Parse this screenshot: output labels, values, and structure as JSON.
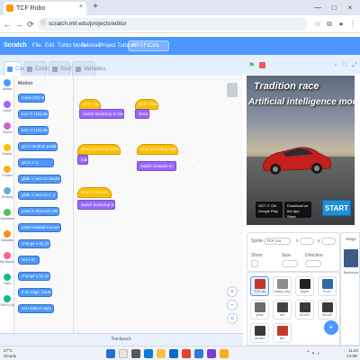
{
  "browser": {
    "tab_title": "TCF Robo",
    "new_tab": "+",
    "close_tab": "×",
    "window_controls": [
      "—",
      "□",
      "×"
    ],
    "url": "scratch.mit.edu/projects/editor",
    "nav": [
      "←",
      "→",
      "⟳"
    ],
    "lock": "ⓘ"
  },
  "menubar": {
    "items": [
      "Scratch",
      "File",
      "Edit",
      "Turbo Mode",
      "Tutorials",
      "Project Tutorial"
    ],
    "project_title": "ARTIFICIAL"
  },
  "editor_tabs": [
    "Code",
    "Costumes",
    "Sounds",
    "Variables"
  ],
  "categories": [
    {
      "name": "Motion",
      "color": "#4c97ff"
    },
    {
      "name": "Looks",
      "color": "#9966ff"
    },
    {
      "name": "Sound",
      "color": "#cf63cf"
    },
    {
      "name": "Events",
      "color": "#ffbf00"
    },
    {
      "name": "Control",
      "color": "#ffab19"
    },
    {
      "name": "Sensing",
      "color": "#5cb1d6"
    },
    {
      "name": "Operators",
      "color": "#59c059"
    },
    {
      "name": "Variables",
      "color": "#ff8c1a"
    },
    {
      "name": "My Blocks",
      "color": "#ff6680"
    },
    {
      "name": "Video",
      "color": "#0fbd8c"
    },
    {
      "name": "Text to Speech",
      "color": "#0fbd8c"
    }
  ],
  "palette": {
    "heading": "Motion",
    "blocks": [
      "move (10) steps",
      "turn ↻ (15) degrees",
      "turn ↺ (15) degrees",
      "go to random position",
      "go to x: y:",
      "glide 1 secs to random position",
      "glide 1 secs to x: y:",
      "point in direction (90)",
      "point towards mouse-pointer",
      "change x by (10)",
      "set x to",
      "change y by (10)",
      "if on edge, bounce",
      "set rotation style"
    ]
  },
  "scripts": {
    "stack1_hat": "when clicked",
    "stack1_b1": "switch backdrop to backdrop1",
    "stack2_hat": "when clicked",
    "stack2_b1": "show",
    "stack3_hat": "when backdrop switches to",
    "stack3_b1": "hide",
    "stack4_hat": "when backdrop switches to",
    "stack4_b1": "switch costume to",
    "stack5_hat": "when I receive",
    "stack5_b1": "switch backdrop to"
  },
  "zoom": {
    "in": "+",
    "out": "−",
    "reset": "="
  },
  "backpack": "Backpack",
  "stage": {
    "title_line1": "Tradition race",
    "title_line2": "Artificial intelligence mode",
    "google_play": "GET IT ON Google Play",
    "app_store": "Download on the App Store",
    "start": "START"
  },
  "sprite_info": {
    "sprite_label": "Sprite",
    "sprite_name": "TCF car",
    "x_label": "x",
    "y_label": "y",
    "show_label": "Show",
    "size_label": "Size",
    "direction_label": "Direction"
  },
  "sprites": [
    {
      "name": "TCF car",
      "color": "#c0392b",
      "selected": true
    },
    {
      "name": "button_trig",
      "color": "#8e8e8e",
      "selected": false
    },
    {
      "name": "Apple",
      "color": "#222222",
      "selected": false
    },
    {
      "name": "PLAY",
      "color": "#2e6da4",
      "selected": false
    },
    {
      "name": "great",
      "color": "#6b6b6b",
      "selected": false
    },
    {
      "name": "left",
      "color": "#444444",
      "selected": false
    },
    {
      "name": "Arrow1",
      "color": "#3a3a3a",
      "selected": false
    },
    {
      "name": "Arrow2",
      "color": "#3a3a3a",
      "selected": false
    },
    {
      "name": "Arrow3",
      "color": "#3a3a3a",
      "selected": false
    },
    {
      "name": "Bin",
      "color": "#c0392b",
      "selected": false
    }
  ],
  "stage_pane": {
    "label": "Stage",
    "backdrops_label": "Backdrops"
  },
  "add_sprite": "+",
  "taskbar": {
    "weather_temp": "27°C",
    "weather_desc": "Cloudy",
    "time": "11:22",
    "date": "14-09-2023"
  }
}
